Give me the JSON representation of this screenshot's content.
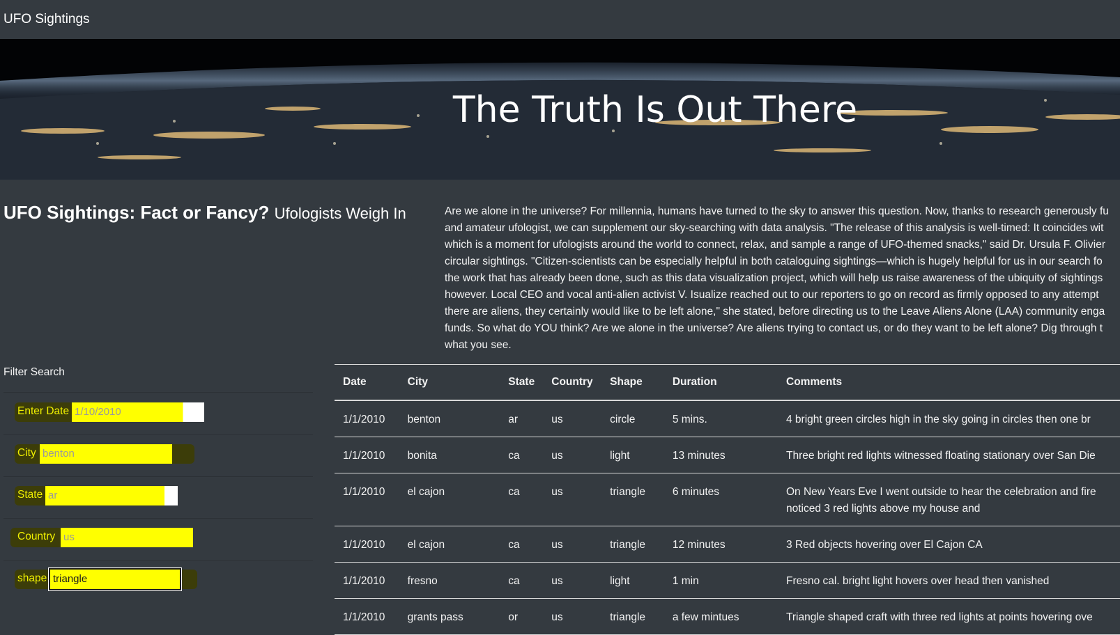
{
  "navbar": {
    "brand": "UFO Sightings"
  },
  "hero": {
    "title": "The Truth Is Out There"
  },
  "article": {
    "title": "UFO Sightings: Fact or Fancy?",
    "subtitle": "Ufologists Weigh In",
    "lines": [
      "Are we alone in the universe? For millennia, humans have turned to the sky to answer this question. Now, thanks to research generously fu",
      "and amateur ufologist, we can supplement our sky-searching with data analysis. \"The release of this analysis is well-timed: It coincides wit",
      "which is a moment for ufologists around the world to connect, relax, and sample a range of UFO-themed snacks,\" said Dr. Ursula F. Olivier",
      "circular sightings. \"Citizen-scientists can be especially helpful in both cataloguing sightings—which is hugely helpful for us in our search fo",
      "the work that has already been done, such as this data visualization project, which will help us raise awareness of the ubiquity of sightings",
      "however. Local CEO and vocal anti-alien activist V. Isualize reached out to our reporters to go on record as firmly opposed to any attempt",
      "there are aliens, they certainly would like to be left alone,\" she stated, before directing us to the Leave Aliens Alone (LAA) community enga",
      "funds. So what do YOU think? Are we alone in the universe? Are aliens trying to contact us, or do they want to be left alone? Dig through t",
      "what you see."
    ]
  },
  "filters": {
    "title": "Filter Search",
    "date": {
      "label": "Enter Date",
      "placeholder": "1/10/2010"
    },
    "city": {
      "label": "City",
      "placeholder": "benton"
    },
    "state": {
      "label": "State",
      "placeholder": "ar"
    },
    "country": {
      "label": "Country",
      "placeholder": "us"
    },
    "shape": {
      "label": "shape",
      "value": "triangle"
    }
  },
  "table": {
    "headers": [
      "Date",
      "City",
      "State",
      "Country",
      "Shape",
      "Duration",
      "Comments"
    ],
    "rows": [
      [
        "1/1/2010",
        "benton",
        "ar",
        "us",
        "circle",
        "5 mins.",
        "4 bright green circles high in the sky going in circles then one br"
      ],
      [
        "1/1/2010",
        "bonita",
        "ca",
        "us",
        "light",
        "13 minutes",
        "Three bright red lights witnessed floating stationary over San Die"
      ],
      [
        "1/1/2010",
        "el cajon",
        "ca",
        "us",
        "triangle",
        "6 minutes",
        "On New Years Eve I went outside to hear the celebration and fire noticed 3 red lights above my house and"
      ],
      [
        "1/1/2010",
        "el cajon",
        "ca",
        "us",
        "triangle",
        "12 minutes",
        "3 Red objects hovering over El Cajon CA"
      ],
      [
        "1/1/2010",
        "fresno",
        "ca",
        "us",
        "light",
        "1 min",
        "Fresno cal. bright light hovers over head then vanished"
      ],
      [
        "1/1/2010",
        "grants pass",
        "or",
        "us",
        "triangle",
        "a few mintues",
        "Triangle shaped craft with three red lights at points hovering ove"
      ]
    ]
  },
  "colors": {
    "highlight": "#ffff00",
    "background": "#343a40"
  }
}
